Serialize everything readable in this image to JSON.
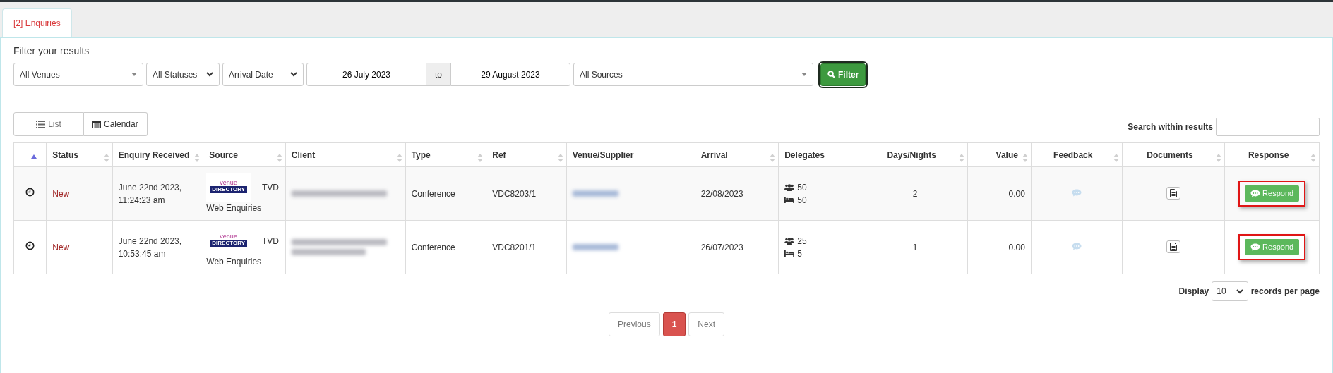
{
  "tabs": [
    {
      "label": "[2] Enquiries",
      "selected": true
    }
  ],
  "filter": {
    "heading": "Filter your results",
    "venues": "All Venues",
    "statuses": "All Statuses",
    "date_type": "Arrival Date",
    "date_from": "26 July 2023",
    "to_label": "to",
    "date_to": "29 August 2023",
    "sources": "All Sources",
    "button": "Filter",
    "button_focused": true
  },
  "views": [
    {
      "label": "List",
      "selected": true
    },
    {
      "label": "Calendar",
      "selected": false
    }
  ],
  "search": {
    "label": "Search within results"
  },
  "table": {
    "columns": [
      {
        "sortable": true,
        "sorted": true
      },
      {
        "label": "Status",
        "sortable": true,
        "sorted": false
      },
      {
        "label": "Enquiry Received",
        "sortable": true,
        "sorted": false
      },
      {
        "label": "Source",
        "sortable": true,
        "sorted": false
      },
      {
        "label": "Client",
        "sortable": true,
        "sorted": false
      },
      {
        "label": "Type",
        "sortable": true,
        "sorted": false
      },
      {
        "label": "Ref",
        "sortable": true,
        "sorted": false
      },
      {
        "label": "Venue/Supplier",
        "sortable": false
      },
      {
        "label": "Arrival",
        "sortable": true,
        "sorted": false
      },
      {
        "label": "Delegates",
        "sortable": false
      },
      {
        "label": "Days/Nights",
        "sortable": true,
        "sorted": false
      },
      {
        "label": "Value",
        "sortable": true,
        "sorted": false
      },
      {
        "label": "Feedback",
        "sortable": true,
        "sorted": false
      },
      {
        "label": "Documents",
        "sortable": true,
        "sorted": false
      },
      {
        "label": "Response",
        "sortable": true,
        "sorted": false
      }
    ],
    "rows": [
      {
        "status": "New",
        "received": [
          "June 22nd 2023,",
          "11:24:23 am"
        ],
        "logo": [
          "venue",
          "DIRECTORY"
        ],
        "source_code": "TVD",
        "source": "Web Enquiries",
        "type": "Conference",
        "ref": "VDC8203/1",
        "arrival": "22/08/2023",
        "delegates": "50",
        "rooms": "50",
        "days": "2",
        "value": "0.00",
        "has_feedback": false,
        "respond": "Respond",
        "highlighted": true
      },
      {
        "status": "New",
        "received": [
          "June 22nd 2023,",
          "10:53:45 am"
        ],
        "logo": [
          "venue",
          "DIRECTORY"
        ],
        "source_code": "TVD",
        "source": "Web Enquiries",
        "type": "Conference",
        "ref": "VDC8201/1",
        "arrival": "26/07/2023",
        "delegates": "25",
        "rooms": "5",
        "days": "1",
        "value": "0.00",
        "has_feedback": false,
        "respond": "Respond",
        "highlighted": true
      }
    ]
  },
  "page_size": {
    "label_before": "Display",
    "value": "10",
    "label_after": "records per page"
  },
  "pagination": [
    {
      "label": "Previous",
      "selected": false
    },
    {
      "label": "1",
      "selected": true
    },
    {
      "label": "Next",
      "selected": false
    }
  ]
}
